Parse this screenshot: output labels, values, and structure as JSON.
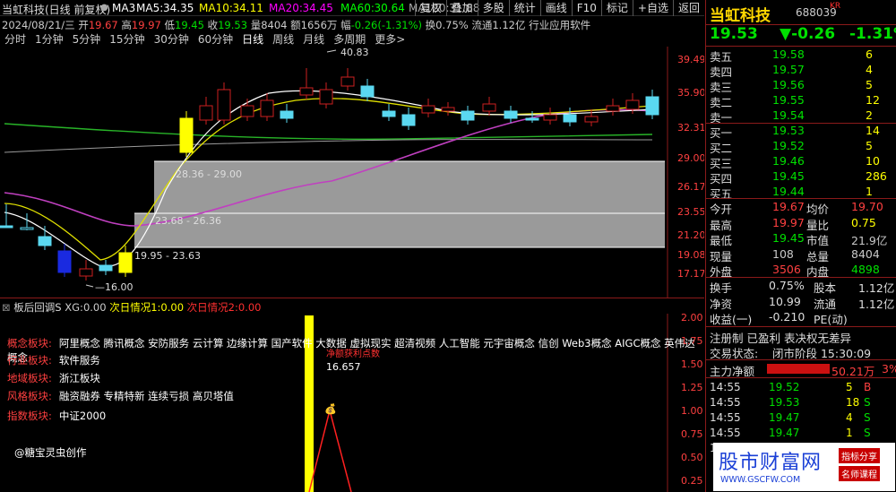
{
  "header": {
    "title": "当虹科技(日线 前复权)",
    "ma": [
      {
        "label": "MA3",
        "value": "",
        "color": "#ffffff"
      },
      {
        "label": "MA5:",
        "value": "34.35",
        "color": "#ffffff"
      },
      {
        "label": "MA10:",
        "value": "34.11",
        "color": "#ffff00"
      },
      {
        "label": "MA20:",
        "value": "34.45",
        "color": "#ff00ff"
      },
      {
        "label": "MA60:",
        "value": "30.64",
        "color": "#00ff00"
      },
      {
        "label": "MA120:",
        "value": "31.88",
        "color": "#aaaaaa"
      }
    ],
    "toolbar": [
      "复权",
      "叠加",
      "多股",
      "统计",
      "画线",
      "F10",
      "标记",
      "+自选",
      "返回"
    ],
    "info_line": {
      "date": "2024/08/21/三",
      "open_label": "开",
      "open": "19.67",
      "high_label": "高",
      "high": "19.97",
      "low_label": "低",
      "low": "19.45",
      "close_label": "收",
      "close": "19.53",
      "vol_label": "量",
      "vol": "8404",
      "amount_label": "额",
      "amount": "1656万",
      "chg_label": "幅",
      "chg": "-0.26(-1.31%)",
      "turn_label": "换",
      "turn": "0.75%",
      "float_label": "流通",
      "float": "1.12亿",
      "industry_label": "行业",
      "industry": "应用软件"
    },
    "timeframes": [
      "分时",
      "1分钟",
      "5分钟",
      "15分钟",
      "30分钟",
      "60分钟",
      "日线",
      "周线",
      "月线",
      "多周期",
      "更多>"
    ],
    "active_timeframe": 6
  },
  "price_axis": [
    "39.49",
    "35.90",
    "32.31",
    "29.00",
    "26.17",
    "23.55",
    "21.20",
    "19.08",
    "17.17"
  ],
  "chart_annotations": {
    "high": "40.83",
    "low": "16.00",
    "zones": [
      "28.36 - 29.00",
      "23.68 - 26.36",
      "19.95 - 23.63"
    ]
  },
  "indicator": {
    "title": "板后回调S",
    "xg_label": "XG:",
    "xg": "0.00",
    "s1_label": "次日情况1:",
    "s1": "0.00",
    "s2_label": "次日情况2:",
    "s2": "0.00",
    "axis": [
      "2.00",
      "1.75",
      "1.50",
      "1.25",
      "1.00",
      "0.75",
      "0.50",
      "0.25"
    ],
    "tags": [
      {
        "key": "概念板块:",
        "value": "阿里概念 腾讯概念 安防服务 云计算 边缘计算 国产软件 大数据 虚拟现实 超清视频 人工智能 元宇宙概念 信创 Web3概念 AIGC概念 英伟达概念"
      },
      {
        "key": "行业板块:",
        "value": "软件服务"
      },
      {
        "key": "地域板块:",
        "value": "浙江板块"
      },
      {
        "key": "风格板块:",
        "value": "融资融券 专精特新 连续亏损 高贝塔值"
      },
      {
        "key": "指数板块:",
        "value": "中证2000"
      }
    ],
    "profit_label": "净额获利点数",
    "profit_value": "16.657",
    "credit": "@糖宝灵虫创作"
  },
  "quote": {
    "name": "当虹科技",
    "code": "688039",
    "tag": "KR",
    "price": "19.53",
    "change": "▼-0.26",
    "pct": "-1.31%",
    "sells": [
      {
        "label": "卖五",
        "price": "19.58",
        "vol": "6"
      },
      {
        "label": "卖四",
        "price": "19.57",
        "vol": "4"
      },
      {
        "label": "卖三",
        "price": "19.56",
        "vol": "5"
      },
      {
        "label": "卖二",
        "price": "19.55",
        "vol": "12"
      },
      {
        "label": "卖一",
        "price": "19.54",
        "vol": "2"
      }
    ],
    "buys": [
      {
        "label": "买一",
        "price": "19.53",
        "vol": "14"
      },
      {
        "label": "买二",
        "price": "19.52",
        "vol": "5"
      },
      {
        "label": "买三",
        "price": "19.46",
        "vol": "10"
      },
      {
        "label": "买四",
        "price": "19.45",
        "vol": "286"
      },
      {
        "label": "买五",
        "price": "19.44",
        "vol": "1"
      }
    ],
    "stats": [
      {
        "l1": "今开",
        "v1": "19.67",
        "c1": "#ff4040",
        "l2": "均价",
        "v2": "19.70",
        "c2": "#ff4040"
      },
      {
        "l1": "最高",
        "v1": "19.97",
        "c1": "#ff4040",
        "l2": "量比",
        "v2": "0.75",
        "c2": "#ffff00"
      },
      {
        "l1": "最低",
        "v1": "19.45",
        "c1": "#00e000",
        "l2": "市值",
        "v2": "21.9亿",
        "c2": "#c8c8c8"
      },
      {
        "l1": "现量",
        "v1": "108",
        "c1": "#c8c8c8",
        "l2": "总量",
        "v2": "8404",
        "c2": "#c8c8c8"
      },
      {
        "l1": "外盘",
        "v1": "3506",
        "c1": "#ff4040",
        "l2": "内盘",
        "v2": "4898",
        "c2": "#00e000"
      }
    ],
    "stats2": [
      {
        "l1": "换手",
        "v1": "0.75%",
        "l2": "股本",
        "v2": "1.12亿"
      },
      {
        "l1": "净资",
        "v1": "10.99",
        "l2": "流通",
        "v2": "1.12亿"
      },
      {
        "l1": "收益(一)",
        "v1": "-0.210",
        "l2": "PE(动)",
        "v2": ""
      }
    ],
    "notice": "注册制 已盈利 表决权无差异",
    "status_label": "交易状态:",
    "status": "闭市阶段 15:30:09",
    "main_flow_label": "主力净额",
    "main_flow": "50.21万",
    "main_flow_pct": "3%",
    "ticks": [
      {
        "time": "14:55",
        "price": "19.52",
        "vol": "5",
        "side": "B"
      },
      {
        "time": "14:55",
        "price": "19.53",
        "vol": "18",
        "side": "S"
      },
      {
        "time": "14:55",
        "price": "19.47",
        "vol": "4",
        "side": "S"
      },
      {
        "time": "14:55",
        "price": "19.47",
        "vol": "1",
        "side": "S"
      },
      {
        "time": "14:55",
        "price": "19.47",
        "vol": "",
        "side": ""
      }
    ]
  },
  "watermark": {
    "name": "股市财富网",
    "url": "WWW.GSCFW.COM",
    "tag1": "指标分享",
    "tag2": "名师课程"
  }
}
